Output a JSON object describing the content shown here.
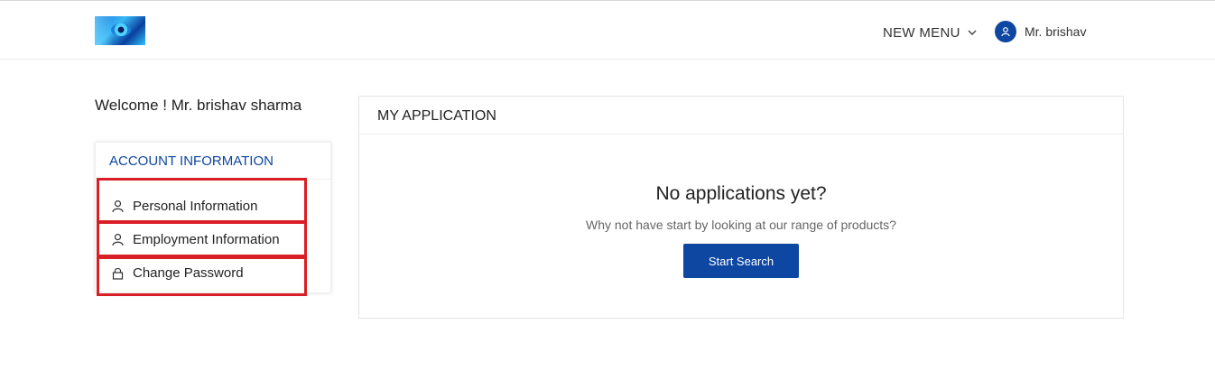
{
  "header": {
    "logo_alt": "eye logo",
    "menu_label": "NEW MENU",
    "menu_icon": "chevron-down-icon",
    "user_icon": "user-icon",
    "user_name": "Mr. brishav"
  },
  "welcome_text": "Welcome ! Mr. brishav sharma",
  "account": {
    "title": "ACCOUNT INFORMATION",
    "items": [
      {
        "label": "Personal Information",
        "icon": "user-icon"
      },
      {
        "label": "Employment Information",
        "icon": "user-icon"
      },
      {
        "label": "Change Password",
        "icon": "lock-icon"
      }
    ]
  },
  "application": {
    "title": "MY APPLICATION",
    "empty_title": "No applications yet?",
    "empty_subtitle": "Why not have start by looking at our range of products?",
    "button_label": "Start Search"
  },
  "colors": {
    "primary": "#0d47a1",
    "highlight": "#d91f26"
  }
}
